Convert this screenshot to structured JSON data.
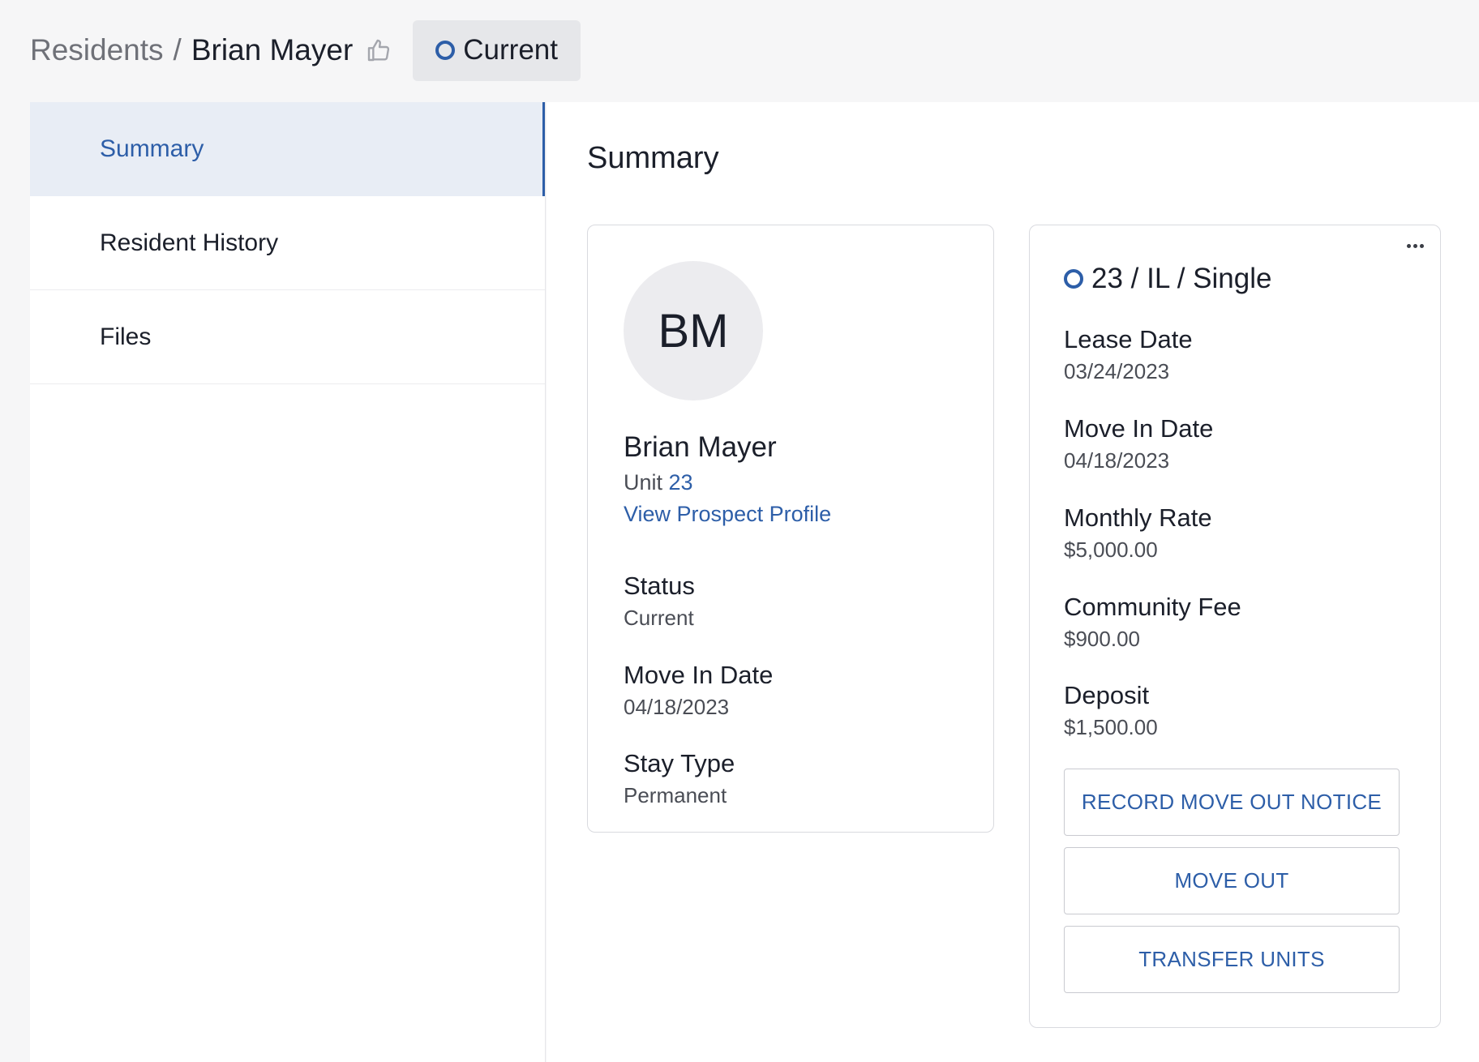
{
  "breadcrumb": {
    "root": "Residents",
    "separator": "/",
    "current": "Brian Mayer"
  },
  "status_pill": {
    "label": "Current"
  },
  "sidebar": {
    "items": [
      {
        "label": "Summary",
        "active": true
      },
      {
        "label": "Resident History",
        "active": false
      },
      {
        "label": "Files",
        "active": false
      }
    ]
  },
  "main": {
    "title": "Summary"
  },
  "profile": {
    "initials": "BM",
    "name": "Brian Mayer",
    "unit_prefix": "Unit",
    "unit_number": "23",
    "prospect_link": "View Prospect Profile",
    "fields": [
      {
        "label": "Status",
        "value": "Current"
      },
      {
        "label": "Move In Date",
        "value": "04/18/2023"
      },
      {
        "label": "Stay Type",
        "value": "Permanent"
      }
    ]
  },
  "unit_card": {
    "title": "23 / IL / Single",
    "fields": [
      {
        "label": "Lease Date",
        "value": "03/24/2023"
      },
      {
        "label": "Move In Date",
        "value": "04/18/2023"
      },
      {
        "label": "Monthly Rate",
        "value": "$5,000.00"
      },
      {
        "label": "Community Fee",
        "value": "$900.00"
      },
      {
        "label": "Deposit",
        "value": "$1,500.00"
      }
    ],
    "actions": [
      {
        "label": "RECORD MOVE OUT NOTICE"
      },
      {
        "label": "MOVE OUT"
      },
      {
        "label": "TRANSFER UNITS"
      }
    ]
  },
  "colors": {
    "accent": "#2d5ea8",
    "active_bg": "#e8edf5",
    "page_bg": "#f6f6f7"
  },
  "icons": {
    "like": "thumbs-up-icon",
    "status": "ring-icon",
    "more": "more-horizontal-icon"
  }
}
